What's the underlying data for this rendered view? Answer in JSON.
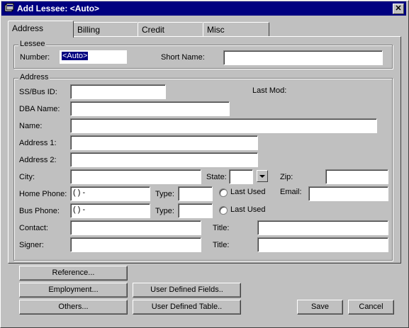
{
  "window": {
    "title": "Add Lessee: <Auto>",
    "close_glyph": "✕"
  },
  "tabs": [
    {
      "label": "Address"
    },
    {
      "label": "Billing"
    },
    {
      "label": "Credit"
    },
    {
      "label": "Misc"
    }
  ],
  "lessee": {
    "group_label": "Lessee",
    "number_label": "Number:",
    "number_value": "<Auto>",
    "short_name_label": "Short Name:"
  },
  "address": {
    "group_label": "Address",
    "ssbus_label": "SS/Bus ID:",
    "last_mod_label": "Last Mod:",
    "dba_label": "DBA Name:",
    "name_label": "Name:",
    "address1_label": "Address 1:",
    "address2_label": "Address 2:",
    "city_label": "City:",
    "state_label": "State:",
    "zip_label": "Zip:",
    "home_phone_label": "Home Phone:",
    "home_phone_value": "(   )    -",
    "bus_phone_label": "Bus Phone:",
    "bus_phone_value": "(   )    -",
    "type_label": "Type:",
    "last_used_label": "Last Used",
    "email_label": "Email:",
    "contact_label": "Contact:",
    "signer_label": "Signer:",
    "title_label": "Title:"
  },
  "buttons": {
    "reference": "Reference...",
    "employment": "Employment...",
    "others": "Others...",
    "user_defined_fields": "User Defined Fields..",
    "user_defined_table": "User Defined Table..",
    "save": "Save",
    "cancel": "Cancel"
  }
}
